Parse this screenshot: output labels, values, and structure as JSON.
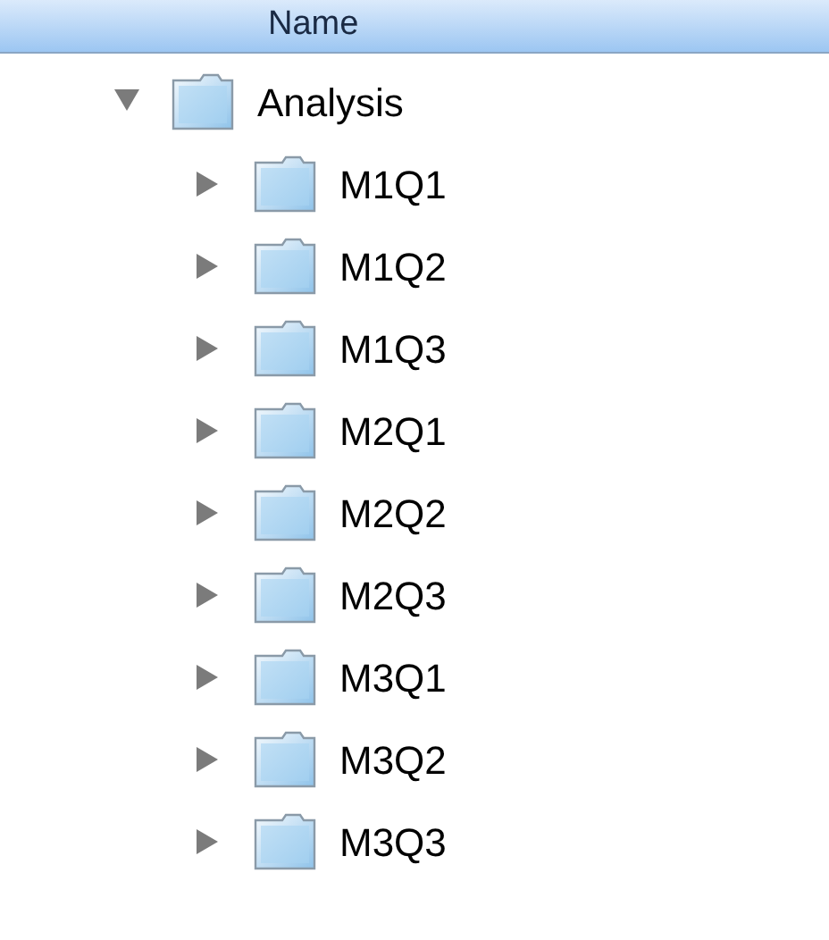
{
  "column_header": {
    "label": "Name"
  },
  "tree": [
    {
      "name": "Analysis",
      "expanded": true,
      "children": [
        {
          "name": "M1Q1",
          "expanded": false
        },
        {
          "name": "M1Q2",
          "expanded": false
        },
        {
          "name": "M1Q3",
          "expanded": false
        },
        {
          "name": "M2Q1",
          "expanded": false
        },
        {
          "name": "M2Q2",
          "expanded": false
        },
        {
          "name": "M2Q3",
          "expanded": false
        },
        {
          "name": "M3Q1",
          "expanded": false
        },
        {
          "name": "M3Q2",
          "expanded": false
        },
        {
          "name": "M3Q3",
          "expanded": false
        }
      ]
    }
  ]
}
